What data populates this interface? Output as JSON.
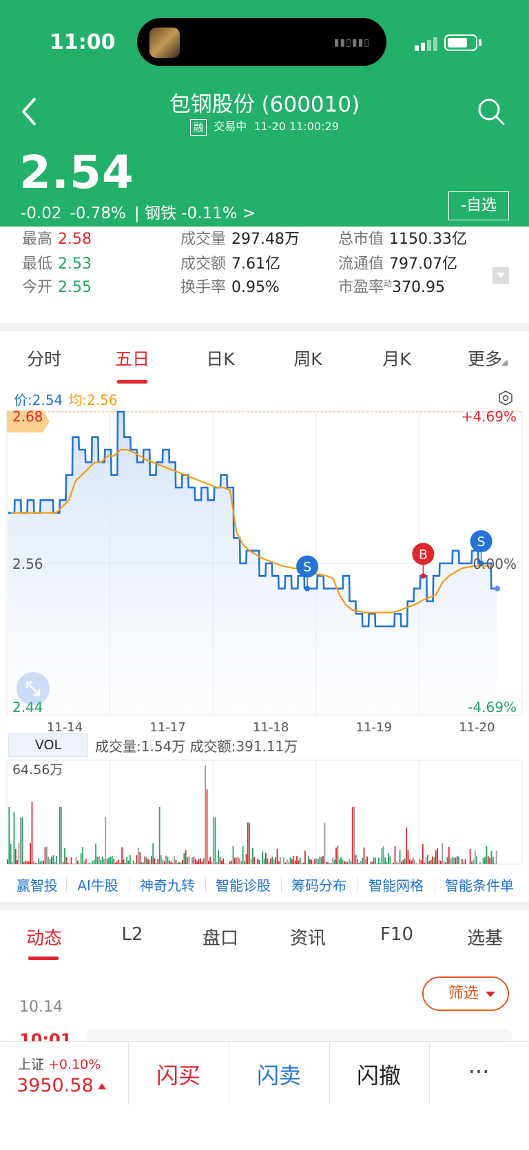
{
  "status_bar": {
    "time": "11:00"
  },
  "stock": {
    "title": "包钢股份 (600010)",
    "badge": "融",
    "status": "交易中",
    "datetime": "11-20 11:00:29",
    "price": "2.54",
    "change": "-0.02",
    "change_pct": "-0.78%",
    "sector_text": "| 钢铁 -0.11% >",
    "watch_button": "-自选"
  },
  "stats": [
    {
      "label": "最高",
      "value": "2.58",
      "color": "red"
    },
    {
      "label": "最低",
      "value": "2.53",
      "color": "green"
    },
    {
      "label": "今开",
      "value": "2.55",
      "color": "green"
    },
    {
      "label": "成交量",
      "value": "297.48万",
      "color": "dark"
    },
    {
      "label": "成交额",
      "value": "7.61亿",
      "color": "dark"
    },
    {
      "label": "换手率",
      "value": "0.95%",
      "color": "dark"
    },
    {
      "label": "总市值",
      "value": "1150.33亿",
      "color": "dark"
    },
    {
      "label": "流通值",
      "value": "797.07亿",
      "color": "dark"
    },
    {
      "label": "市盈率",
      "value": "370.95",
      "color": "dark",
      "superscript": "动"
    }
  ],
  "chart_tabs": [
    "分时",
    "五日",
    "日K",
    "周K",
    "月K",
    "更多"
  ],
  "legend": {
    "price": "价:2.54",
    "avg": "均:2.56"
  },
  "chart_data": {
    "type": "line",
    "y_axis_left": [
      "2.68",
      "2.56",
      "2.44"
    ],
    "y_axis_right": [
      "+4.69%",
      "0.00%",
      "-4.69%"
    ],
    "ylim": [
      2.44,
      2.68
    ],
    "x_labels": [
      "11-14",
      "11-17",
      "11-18",
      "11-19",
      "11-20"
    ],
    "series": [
      {
        "name": "价",
        "color": "#2474d6",
        "values": [
          2.6,
          2.61,
          2.6,
          2.61,
          2.6,
          2.61,
          2.61,
          2.6,
          2.61,
          2.63,
          2.66,
          2.65,
          2.64,
          2.66,
          2.64,
          2.65,
          2.63,
          2.68,
          2.66,
          2.65,
          2.64,
          2.65,
          2.63,
          2.64,
          2.65,
          2.64,
          2.62,
          2.63,
          2.62,
          2.61,
          2.62,
          2.61,
          2.62,
          2.63,
          2.62,
          2.58,
          2.56,
          2.57,
          2.57,
          2.55,
          2.56,
          2.55,
          2.54,
          2.55,
          2.54,
          2.55,
          2.54,
          2.54,
          2.55,
          2.54,
          2.54,
          2.54,
          2.55,
          2.53,
          2.52,
          2.51,
          2.52,
          2.51,
          2.51,
          2.51,
          2.52,
          2.51,
          2.53,
          2.54,
          2.55,
          2.53,
          2.55,
          2.56,
          2.56,
          2.57,
          2.56,
          2.56,
          2.57,
          2.56,
          2.56,
          2.54
        ]
      },
      {
        "name": "均",
        "color": "#f39c12",
        "values": [
          2.6,
          2.6,
          2.6,
          2.6,
          2.6,
          2.6,
          2.6,
          2.6,
          2.605,
          2.61,
          2.625,
          2.63,
          2.635,
          2.64,
          2.64,
          2.645,
          2.645,
          2.65,
          2.65,
          2.648,
          2.645,
          2.642,
          2.64,
          2.638,
          2.636,
          2.634,
          2.632,
          2.63,
          2.628,
          2.626,
          2.624,
          2.622,
          2.62,
          2.62,
          2.618,
          2.585,
          2.575,
          2.57,
          2.567,
          2.564,
          2.562,
          2.56,
          2.558,
          2.557,
          2.556,
          2.555,
          2.553,
          2.552,
          2.551,
          2.55,
          2.548,
          2.535,
          2.527,
          2.523,
          2.522,
          2.521,
          2.521,
          2.521,
          2.521,
          2.521,
          2.522,
          2.524,
          2.526,
          2.528,
          2.531,
          2.533,
          2.535,
          2.545,
          2.55,
          2.553,
          2.556,
          2.557,
          2.558,
          2.558,
          2.558,
          2.558
        ]
      }
    ],
    "markers": [
      {
        "label": "S",
        "index": 46,
        "color": "#2474d6"
      },
      {
        "label": "B",
        "index": 64,
        "color": "#e0262e"
      },
      {
        "label": "S",
        "index": 73,
        "color": "#2474d6"
      }
    ]
  },
  "volume": {
    "tag": "VOL",
    "info": "成交量:1.54万 成交额:391.11万",
    "max_label": "64.56万"
  },
  "tools": [
    "赢智投",
    "AI牛股",
    "神奇九转",
    "智能诊股",
    "筹码分布",
    "智能网格",
    "智能条件单"
  ],
  "info_tabs": [
    "动态",
    "L2",
    "盘口",
    "资讯",
    "F10",
    "选基"
  ],
  "filter_button": "筛选",
  "feed": {
    "date": "10.14",
    "time": "10:01"
  },
  "bottom": {
    "index_name": "上证",
    "index_pct": "+0.10%",
    "index_value": "3950.58",
    "buy": "闪买",
    "sell": "闪卖",
    "cancel": "闪撤",
    "more": "···"
  }
}
